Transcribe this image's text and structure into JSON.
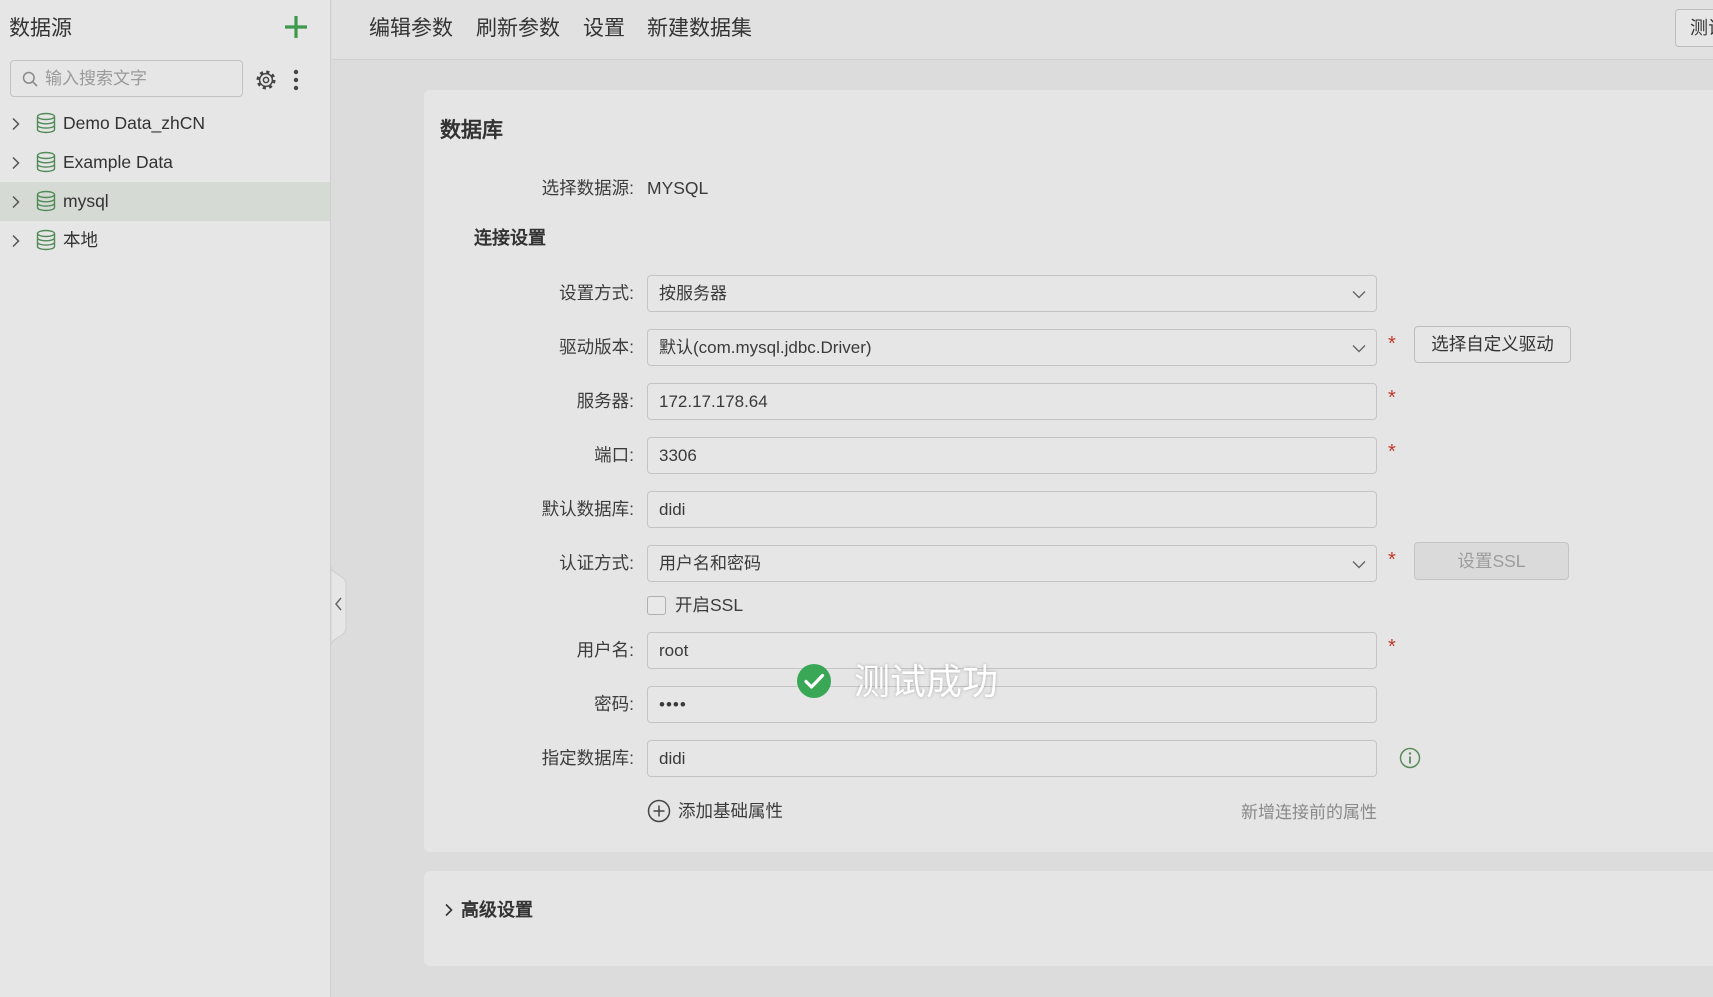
{
  "sidebar": {
    "title": "数据源",
    "search_placeholder": "输入搜索文字",
    "icons": {
      "add": "plus-icon",
      "search": "search-icon",
      "settings": "gear-icon",
      "more": "kebab-icon",
      "item": "database-icon"
    },
    "items": [
      {
        "label": "Demo Data_zhCN",
        "selected": false
      },
      {
        "label": "Example Data",
        "selected": false
      },
      {
        "label": "mysql",
        "selected": true
      },
      {
        "label": "本地",
        "selected": false
      }
    ]
  },
  "toolbar": {
    "items": [
      "编辑参数",
      "刷新参数",
      "设置",
      "新建数据集"
    ],
    "right_button": "测试"
  },
  "form": {
    "section_title": "数据库",
    "datasource_label": "选择数据源:",
    "datasource_value": "MYSQL",
    "connection_title": "连接设置",
    "required_mark": "*",
    "fields": [
      {
        "label": "设置方式:",
        "value": "按服务器",
        "kind": "dropdown",
        "required": false
      },
      {
        "label": "驱动版本:",
        "value": "默认(com.mysql.jdbc.Driver)",
        "kind": "dropdown",
        "required": true
      },
      {
        "label": "服务器:",
        "value": "172.17.178.64",
        "kind": "text",
        "required": true
      },
      {
        "label": "端口:",
        "value": "3306",
        "kind": "text",
        "required": true
      },
      {
        "label": "默认数据库:",
        "value": "didi",
        "kind": "text",
        "required": false
      },
      {
        "label": "认证方式:",
        "value": "用户名和密码",
        "kind": "dropdown",
        "required": true
      },
      {
        "label": "用户名:",
        "value": "root",
        "kind": "text",
        "required": true
      },
      {
        "label": "密码:",
        "value": "••••",
        "kind": "password",
        "required": false
      },
      {
        "label": "指定数据库:",
        "value": "didi",
        "kind": "text",
        "required": false
      }
    ],
    "ssl_checkbox": {
      "label": "开启SSL",
      "checked": false
    },
    "custom_driver_button": "选择自定义驱动",
    "ssl_button": {
      "label": "设置SSL",
      "disabled": true
    },
    "add_property": "添加基础属性",
    "add_property_hint": "新增连接前的属性",
    "advanced_title": "高级设置"
  },
  "toast": {
    "text": "测试成功",
    "status": "success",
    "icon": "check-circle-icon"
  },
  "colors": {
    "accent": "#3d9a4c",
    "database_icon": "#4f8a57",
    "required": "#c0392b",
    "success": "#3aa757"
  }
}
